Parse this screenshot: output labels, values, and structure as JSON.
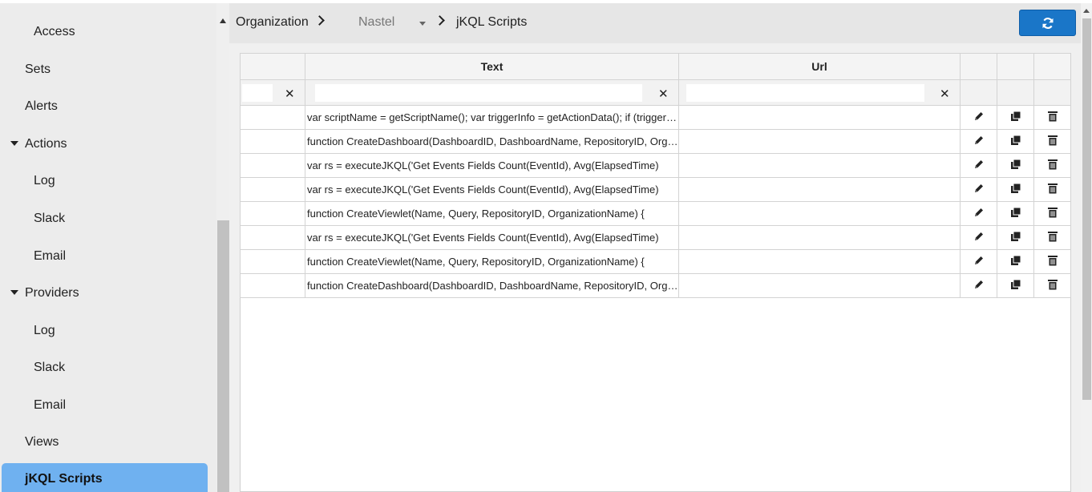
{
  "sidebar": {
    "items": [
      {
        "label": "Access"
      },
      {
        "label": "Sets"
      },
      {
        "label": "Alerts"
      },
      {
        "label": "Actions"
      },
      {
        "label": "Log"
      },
      {
        "label": "Slack"
      },
      {
        "label": "Email"
      },
      {
        "label": "Providers"
      },
      {
        "label": "Log"
      },
      {
        "label": "Slack"
      },
      {
        "label": "Email"
      },
      {
        "label": "Views"
      }
    ],
    "active": "jKQL Scripts"
  },
  "breadcrumb": {
    "organization": "Organization",
    "repository": "Nastel",
    "current": "jKQL Scripts"
  },
  "grid": {
    "columns": [
      "",
      "Text",
      "Url",
      "",
      "",
      ""
    ],
    "filters": {
      "text": "",
      "url": ""
    },
    "rows": [
      {
        "text": "var scriptName = getScriptName(); var triggerInfo = getActionData(); if (triggerInfo",
        "url": ""
      },
      {
        "text": "function CreateDashboard(DashboardID, DashboardName, RepositoryID, OrganizationName)",
        "url": ""
      },
      {
        "text": "var rs = executeJKQL('Get Events Fields Count(EventId), Avg(ElapsedTime)",
        "url": ""
      },
      {
        "text": "var rs = executeJKQL('Get Events Fields Count(EventId), Avg(ElapsedTime)",
        "url": ""
      },
      {
        "text": "function CreateViewlet(Name, Query, RepositoryID, OrganizationName) {",
        "url": ""
      },
      {
        "text": "var rs = executeJKQL('Get Events Fields Count(EventId), Avg(ElapsedTime)",
        "url": ""
      },
      {
        "text": "function CreateViewlet(Name, Query, RepositoryID, OrganizationName) {",
        "url": ""
      },
      {
        "text": "function CreateDashboard(DashboardID, DashboardName, RepositoryID, OrganizationName)",
        "url": ""
      }
    ]
  },
  "icons": {
    "edit": "pencil-icon",
    "copy": "copy-icon",
    "delete": "trash-icon",
    "refresh": "refresh-icon",
    "clear": "close-icon"
  },
  "colors": {
    "accent": "#1a76c8",
    "active_nav": "#6fb1f0"
  }
}
